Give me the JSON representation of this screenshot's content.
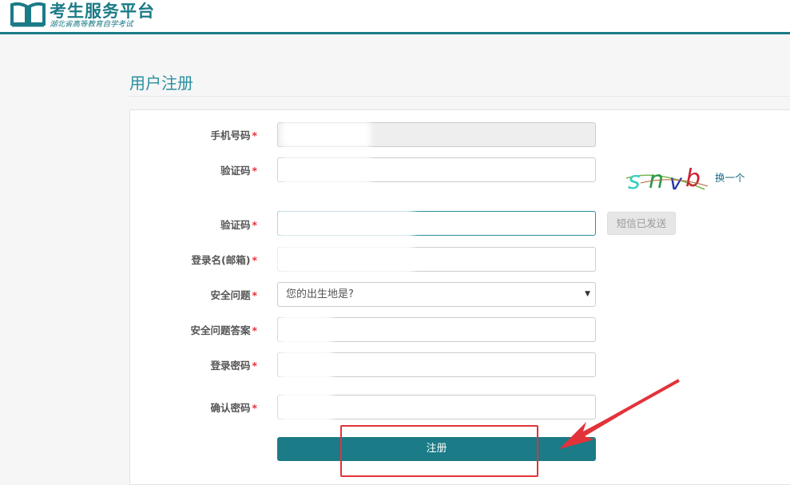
{
  "header": {
    "title": "考生服务平台",
    "subtitle": "湖北省高等教育自学考试"
  },
  "page": {
    "title": "用户注册"
  },
  "form": {
    "required_mark": "*",
    "phone_label": "手机号码",
    "captcha_label": "验证码",
    "captcha_text": "snvb",
    "captcha_refresh": "换一个",
    "sms_code_label": "验证码",
    "sms_button": "短信已发送",
    "login_label": "登录名(邮箱)",
    "question_label": "安全问题",
    "question_selected": "您的出生地是?",
    "answer_label": "安全问题答案",
    "password_label": "登录密码",
    "confirm_label": "确认密码",
    "submit": "注册"
  },
  "colors": {
    "brand": "#1b7b87",
    "accent_title": "#2b8fa0",
    "required": "#e2333a",
    "annotation": "#e2333a"
  }
}
